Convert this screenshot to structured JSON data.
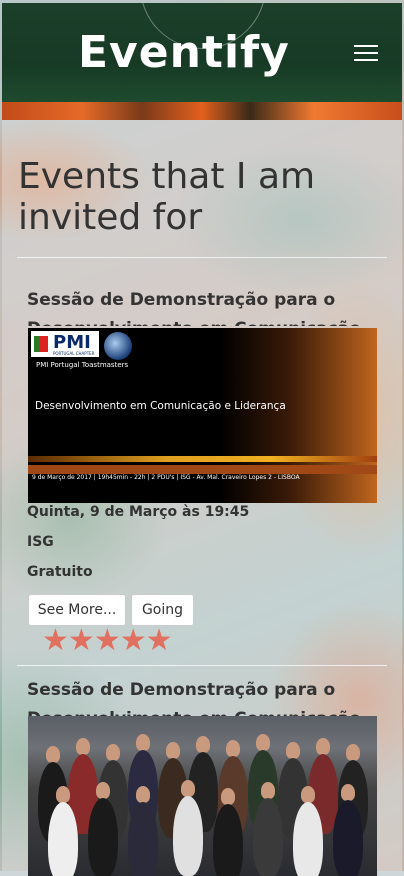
{
  "header": {
    "brand": "Eventify",
    "menu_icon": "hamburger-icon"
  },
  "page": {
    "heading": "Events that I am invited for"
  },
  "events": [
    {
      "title": "Sessão de Demonstração para o Desenvolvimento em Comunicação",
      "date": "Quinta, 9 de Março às 19:45",
      "location": "ISG",
      "price": "Gratuito",
      "see_more_label": "See More...",
      "going_label": "Going",
      "rating": 5,
      "image": {
        "logo_text": "PMI",
        "logo_sub": "PORTUGAL CHAPTER",
        "org_caption": "PMI Portugal Toastmasters",
        "slide_title": "Desenvolvimento em Comunicação e Liderança",
        "slide_footer": "9 de Março de 2017  |  19h45min - 22h  |  2 PDU's  |  ISG - Av. Mal. Craveiro Lopes 2 - LISBOA"
      }
    },
    {
      "title": "Sessão de Demonstração para o Desenvolvimento em Comunicação",
      "image": {
        "description": "group-photo"
      }
    }
  ],
  "colors": {
    "nav_bg": "#173a25",
    "star": "#e07060",
    "text": "#333333"
  }
}
